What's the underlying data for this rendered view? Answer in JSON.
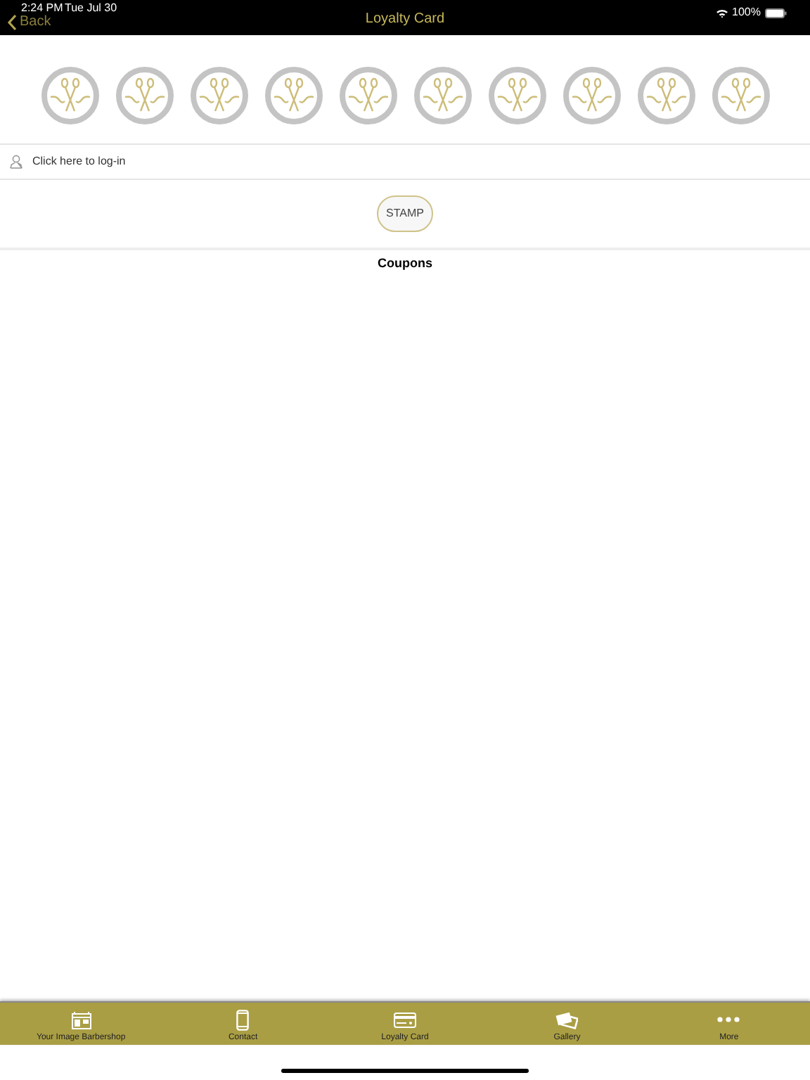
{
  "status_bar": {
    "time": "2:24 PM",
    "date": "Tue Jul 30",
    "battery": "100%"
  },
  "nav_bar": {
    "back": "Back",
    "title": "Loyalty Card"
  },
  "stamps": [
    {
      "kind": "scissors"
    },
    {
      "kind": "scissors"
    },
    {
      "kind": "scissors"
    },
    {
      "kind": "scissors"
    },
    {
      "kind": "scissors"
    },
    {
      "kind": "scissors"
    },
    {
      "kind": "scissors"
    },
    {
      "kind": "scissors"
    },
    {
      "kind": "scissors"
    },
    {
      "kind": "scissors"
    }
  ],
  "login": {
    "label": "Click here to log-in"
  },
  "stamp_button": {
    "label": "STAMP"
  },
  "coupons": {
    "title": "Coupons"
  },
  "tab_bar": [
    {
      "kind": "shop",
      "label": "Your Image Barbershop"
    },
    {
      "kind": "phone",
      "label": "Contact"
    },
    {
      "kind": "card",
      "label": "Loyalty Card"
    },
    {
      "kind": "gallery",
      "label": "Gallery"
    },
    {
      "kind": "more",
      "label": "More"
    }
  ]
}
